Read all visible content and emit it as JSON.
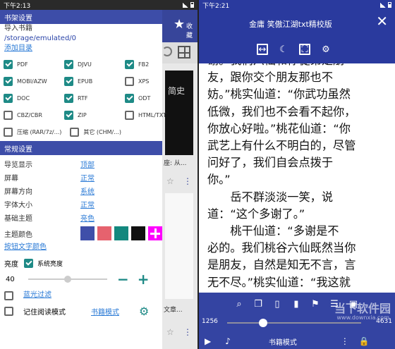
{
  "left_status": {
    "time": "下午2:13"
  },
  "right_status": {
    "time": "下午2:21"
  },
  "background_app": {
    "toolbar_label": "收藏",
    "book_title": "简史",
    "caption1": "座: 从...",
    "caption2": "文章..."
  },
  "drawer": {
    "shelf_section": "书架设置",
    "import_label": "导入书籍",
    "import_path": "/storage/emulated/0",
    "add_dir": "添加目录",
    "formats": [
      {
        "label": "PDF",
        "checked": true
      },
      {
        "label": "DJVU",
        "checked": true
      },
      {
        "label": "FB2",
        "checked": true
      },
      {
        "label": "MOBI/AZW",
        "checked": true
      },
      {
        "label": "EPUB",
        "checked": true
      },
      {
        "label": "XPS",
        "checked": false
      },
      {
        "label": "DOC",
        "checked": true
      },
      {
        "label": "RTF",
        "checked": true
      },
      {
        "label": "ODT",
        "checked": true
      },
      {
        "label": "CBZ/CBR",
        "checked": false
      },
      {
        "label": "ZIP",
        "checked": true
      },
      {
        "label": "HTML/TXT",
        "checked": false
      }
    ],
    "archive_label": "压缩 (RAR/7z/...)",
    "other_label": "其它 (CHM/...)",
    "general_section": "常规设置",
    "settings": [
      {
        "key": "导览显示",
        "value": "顶部"
      },
      {
        "key": "屏幕",
        "value": "正常"
      },
      {
        "key": "屏幕方向",
        "value": "系统"
      },
      {
        "key": "字体大小",
        "value": "正常"
      },
      {
        "key": "基础主题",
        "value": "亮色"
      }
    ],
    "theme_color_label": "主题颜色",
    "theme_colors": [
      "#3f4fa9",
      "#e6626e",
      "#13887e",
      "#111111",
      "#ff00ff"
    ],
    "button_text_color": "按钮文字颜色",
    "brightness_label": "亮度",
    "system_brightness": "系统亮度",
    "brightness_value": "40",
    "brightness_level": 0.5,
    "blue_filter": "蓝光过滤",
    "remember_mode": "记住阅读模式",
    "book_mode_link": "书籍模式"
  },
  "reader": {
    "title": "金庸 笑傲江湖txt精校版",
    "text_lines": [
      "谢。我们六仙和你徒弟是朋",
      "友，跟你交个朋友那也不",
      "妨。”桃实仙道：“你武功虽然",
      "低微，我们也不会看不起你，",
      "你放心好啦。”桃花仙道：“你",
      "武艺上有什么不明白的，尽管",
      "问好了，我们自会点拨于",
      "你。”",
      "　　岳不群淡淡一笑，说",
      "道：“这个多谢了。”",
      "　　桃干仙道：“多谢是不",
      "必的。我们桃谷六仙既然当你",
      "是朋友，自然是知无不言，言",
      "无不尽。”桃实仙道：“我这就"
    ],
    "page_current": "1256",
    "page_total": "4631",
    "progress": 0.271,
    "mode_label": "书籍模式",
    "watermark": "当下软件园",
    "watermark_url": "www.downxia.com"
  }
}
